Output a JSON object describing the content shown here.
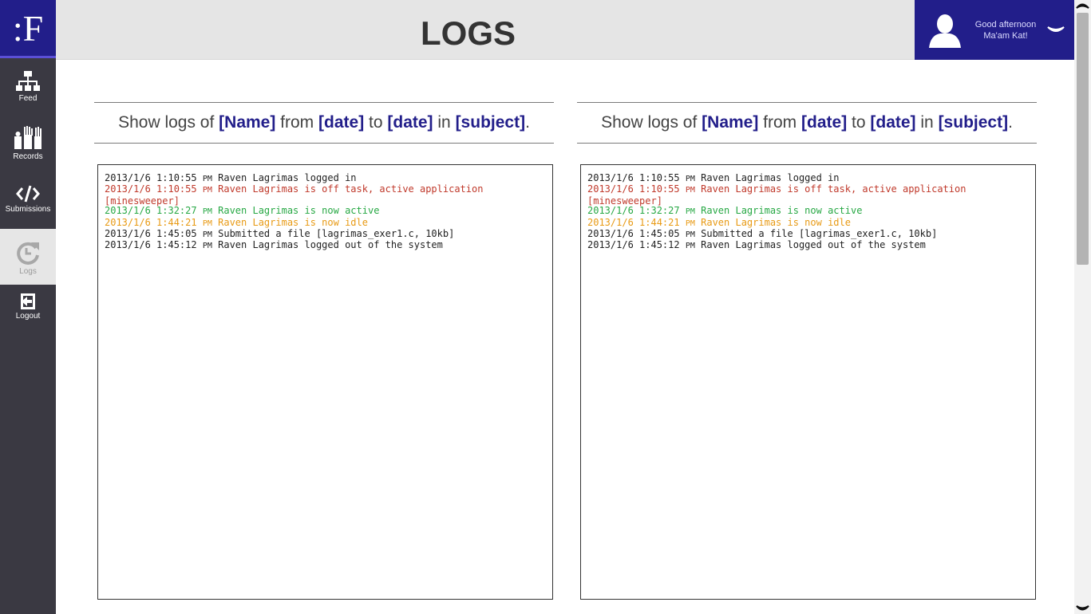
{
  "app": {
    "logo_text": ":F",
    "colors": {
      "brand": "#221e8a",
      "sidebar": "#3a3942",
      "header": "#e5e5e5",
      "offtask": "#c0392b",
      "active": "#27a844",
      "idle": "#e89a14"
    }
  },
  "sidebar": {
    "items": [
      {
        "label": "Feed",
        "icon": "feed-icon"
      },
      {
        "label": "Records",
        "icon": "raised-hands-icon"
      },
      {
        "label": "Submissions",
        "icon": "code-icon"
      },
      {
        "label": "Logs",
        "icon": "refresh-icon",
        "active": true
      },
      {
        "label": "Logout",
        "icon": "logout-icon"
      }
    ]
  },
  "header": {
    "title": "LOGS",
    "greeting_line1": "Good afternoon",
    "greeting_line2": "Ma'am Kat!"
  },
  "panels": [
    {
      "filter": {
        "prefix": "Show logs of ",
        "name": "[Name]",
        "from_word": " from ",
        "date_from": "[date]",
        "to_word": " to ",
        "date_to": "[date]",
        "in_word": " in ",
        "subject": "[subject]",
        "suffix": "."
      },
      "logs": [
        {
          "date": "2013/1/6",
          "time": "1:10:55",
          "ampm": "PM",
          "text": "Raven Lagrimas logged in",
          "type": "normal"
        },
        {
          "date": "2013/1/6",
          "time": "1:10:55",
          "ampm": "PM",
          "text": "Raven Lagrimas is off task, active application [minesweeper]",
          "type": "offtask"
        },
        {
          "date": "2013/1/6",
          "time": "1:32:27",
          "ampm": "PM",
          "text": "Raven Lagrimas is now active",
          "type": "active"
        },
        {
          "date": "2013/1/6",
          "time": "1:44:21",
          "ampm": "PM",
          "text": "Raven Lagrimas is now idle",
          "type": "idle"
        },
        {
          "date": "2013/1/6",
          "time": "1:45:05",
          "ampm": "PM",
          "text": "Submitted a file [lagrimas_exer1.c, 10kb]",
          "type": "normal"
        },
        {
          "date": "2013/1/6",
          "time": "1:45:12",
          "ampm": "PM",
          "text": "Raven Lagrimas logged out of the system",
          "type": "normal"
        }
      ]
    },
    {
      "filter": {
        "prefix": "Show logs of ",
        "name": "[Name]",
        "from_word": " from ",
        "date_from": "[date]",
        "to_word": " to ",
        "date_to": "[date]",
        "in_word": " in ",
        "subject": "[subject]",
        "suffix": "."
      },
      "logs": [
        {
          "date": "2013/1/6",
          "time": "1:10:55",
          "ampm": "PM",
          "text": "Raven Lagrimas logged in",
          "type": "normal"
        },
        {
          "date": "2013/1/6",
          "time": "1:10:55",
          "ampm": "PM",
          "text": "Raven Lagrimas is off task, active application [minesweeper]",
          "type": "offtask"
        },
        {
          "date": "2013/1/6",
          "time": "1:32:27",
          "ampm": "PM",
          "text": "Raven Lagrimas is now active",
          "type": "active"
        },
        {
          "date": "2013/1/6",
          "time": "1:44:21",
          "ampm": "PM",
          "text": "Raven Lagrimas is now idle",
          "type": "idle"
        },
        {
          "date": "2013/1/6",
          "time": "1:45:05",
          "ampm": "PM",
          "text": "Submitted a file [lagrimas_exer1.c, 10kb]",
          "type": "normal"
        },
        {
          "date": "2013/1/6",
          "time": "1:45:12",
          "ampm": "PM",
          "text": "Raven Lagrimas logged out of the system",
          "type": "normal"
        }
      ]
    }
  ]
}
